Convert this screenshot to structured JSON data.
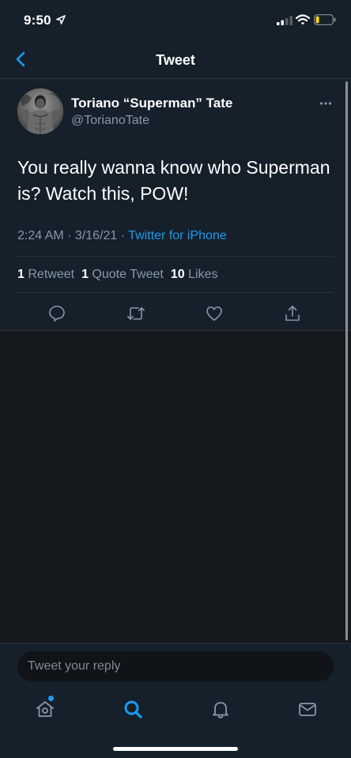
{
  "status_bar": {
    "time": "9:50"
  },
  "header": {
    "title": "Tweet"
  },
  "tweet": {
    "display_name": "Toriano “Superman” Tate",
    "handle": "@TorianoTate",
    "text": "You really wanna know who Superman is? Watch this, POW!",
    "time": "2:24 AM",
    "date": "3/16/21",
    "source": "Twitter for iPhone",
    "retweets_count": "1",
    "retweets_label": "Retweet",
    "quotes_count": "1",
    "quotes_label": "Quote Tweet",
    "likes_count": "10",
    "likes_label": "Likes"
  },
  "actions": [
    "reply-icon",
    "retweet-icon",
    "like-icon",
    "share-icon"
  ],
  "reply": {
    "placeholder": "Tweet your reply"
  },
  "tab_bar": [
    "home-icon",
    "search-icon",
    "notifications-icon",
    "messages-icon"
  ],
  "colors": {
    "accent": "#1d9bf0",
    "background": "#15202b",
    "secondary_text": "#8899a6"
  }
}
